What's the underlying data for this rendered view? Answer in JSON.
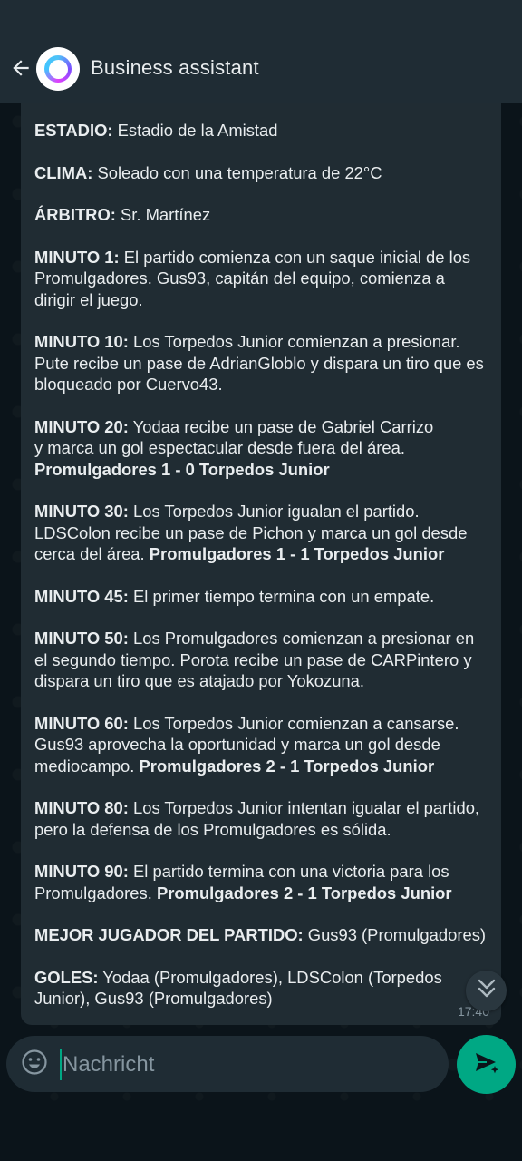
{
  "header": {
    "title": "Business assistant",
    "back_icon": "arrow-left-icon",
    "avatar_icon": "assistant-ring-logo"
  },
  "message": {
    "lines": [
      {
        "label": "ESTADIO:",
        "text": " Estadio de la Amistad",
        "bold_tail": ""
      },
      {
        "label": "CLIMA:",
        "text": " Soleado con una temperatura de 22°C",
        "bold_tail": ""
      },
      {
        "label": "ÁRBITRO:",
        "text": " Sr. Martínez",
        "bold_tail": ""
      },
      {
        "label": "MINUTO 1:",
        "text": " El partido comienza con un saque inicial de los Promulgadores. Gus93, capitán del equipo, comienza a dirigir el juego.",
        "bold_tail": ""
      },
      {
        "label": "MINUTO 10:",
        "text": " Los Torpedos Junior comienzan a presionar. Pute recibe un pase de AdrianGloblo y dispara un tiro que es bloqueado por Cuervo43.",
        "bold_tail": ""
      },
      {
        "label": "MINUTO 20:",
        "text": " Yodaa recibe un pase de Gabriel Carrizo\ny marca un gol espectacular desde fuera del área. ",
        "bold_tail": "Promulgadores 1 - 0 Torpedos Junior"
      },
      {
        "label": "MINUTO 30:",
        "text": " Los Torpedos Junior igualan el partido. LDSColon recibe un pase de Pichon y marca un gol desde cerca del área. ",
        "bold_tail": "Promulgadores 1 - 1 Torpedos Junior"
      },
      {
        "label": "MINUTO 45:",
        "text": " El primer tiempo termina con un empate.",
        "bold_tail": ""
      },
      {
        "label": "MINUTO 50:",
        "text": " Los Promulgadores comienzan a presionar en el segundo tiempo. Porota recibe un pase de CARPintero y dispara un tiro que es atajado por Yokozuna.",
        "bold_tail": ""
      },
      {
        "label": "MINUTO 60:",
        "text": " Los Torpedos Junior comienzan a cansarse. Gus93 aprovecha la oportunidad y marca un gol desde mediocampo. ",
        "bold_tail": "Promulgadores 2 - 1 Torpedos Junior"
      },
      {
        "label": "MINUTO 80:",
        "text": " Los Torpedos Junior intentan igualar el partido, pero la defensa de los Promulgadores es sólida.",
        "bold_tail": ""
      },
      {
        "label": "MINUTO 90:",
        "text": " El partido termina con una victoria para los Promulgadores. ",
        "bold_tail": "Promulgadores 2 - 1 Torpedos Junior"
      },
      {
        "label": "MEJOR JUGADOR DEL PARTIDO:",
        "text": " Gus93 (Promulgadores)",
        "bold_tail": ""
      },
      {
        "label": "GOLES:",
        "text": " Yodaa (Promulgadores), LDSColon (Torpedos Junior), Gus93 (Promulgadores)",
        "bold_tail": ""
      }
    ],
    "timestamp": "17:40"
  },
  "composer": {
    "placeholder": "Nachricht",
    "value": "",
    "emoji_icon": "emoji-smiley-icon",
    "send_icon": "send-sparkle-icon"
  },
  "colors": {
    "accent": "#00a884",
    "header_bg": "#1f2c34",
    "bubble_bg": "#202c33",
    "chat_bg": "#0b141a",
    "text": "#e9edef",
    "muted": "#8696a0"
  }
}
